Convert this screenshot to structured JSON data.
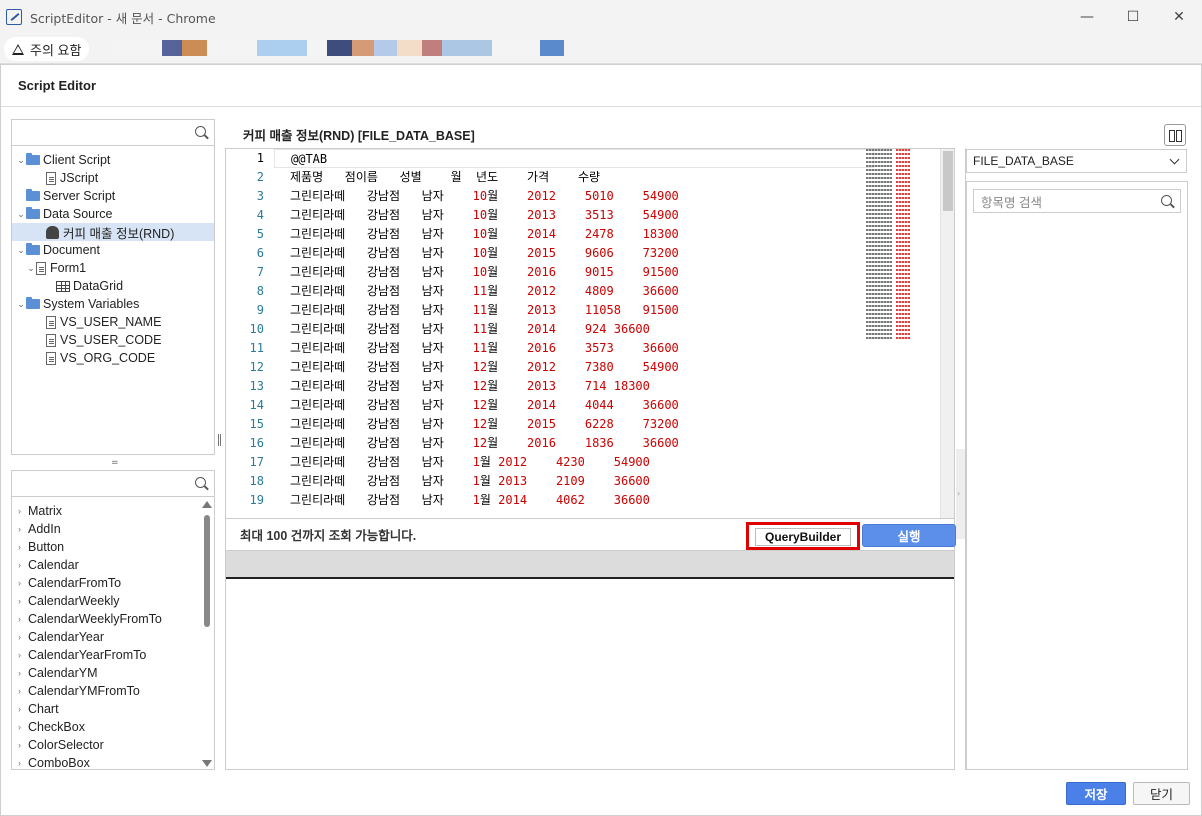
{
  "window": {
    "title": "ScriptEditor - 새 문서 - Chrome",
    "minimize": "—",
    "maximize": "☐",
    "close": "✕"
  },
  "address": {
    "warning": "주의 요함"
  },
  "header": {
    "title": "Script Editor"
  },
  "tree": {
    "items": [
      {
        "label": "Client Script",
        "icon": "folder-icon",
        "caret": "⌄"
      },
      {
        "label": "JScript",
        "icon": "file-icon"
      },
      {
        "label": "Server Script",
        "icon": "folder-icon"
      },
      {
        "label": "Data Source",
        "icon": "folder-icon",
        "caret": "⌄"
      },
      {
        "label": "커피 매출 정보(RND)",
        "icon": "database-icon",
        "selected": true
      },
      {
        "label": "Document",
        "icon": "folder-icon",
        "caret": "⌄"
      },
      {
        "label": "Form1",
        "icon": "file-icon",
        "caret": "⌄"
      },
      {
        "label": "DataGrid",
        "icon": "grid-icon"
      },
      {
        "label": "System Variables",
        "icon": "folder-icon",
        "caret": "⌄"
      },
      {
        "label": "VS_USER_NAME",
        "icon": "file-icon"
      },
      {
        "label": "VS_USER_CODE",
        "icon": "file-icon"
      },
      {
        "label": "VS_ORG_CODE",
        "icon": "file-icon"
      }
    ]
  },
  "splitter": {
    "symbol": "=",
    "vertical": "||"
  },
  "components": {
    "items": [
      "Matrix",
      "AddIn",
      "Button",
      "Calendar",
      "CalendarFromTo",
      "CalendarWeekly",
      "CalendarWeeklyFromTo",
      "CalendarYear",
      "CalendarYearFromTo",
      "CalendarYM",
      "CalendarYMFromTo",
      "Chart",
      "CheckBox",
      "ColorSelector",
      "ComboBox"
    ]
  },
  "editor": {
    "title": "커피 매출 정보(RND)  [FILE_DATA_BASE]",
    "lines": [
      [
        {
          "text": "@@TAB",
          "kind": "t"
        }
      ],
      [
        {
          "text": "제품명   점이름   성별    월  년도    가격    수량",
          "kind": "t"
        }
      ],
      [
        {
          "text": "그린티라떼   강남점   남자    ",
          "kind": "t"
        },
        {
          "text": "10",
          "kind": "n"
        },
        {
          "text": "월",
          "kind": "t"
        },
        {
          "text": "    2012    5010    54900",
          "kind": "n"
        }
      ],
      [
        {
          "text": "그린티라떼   강남점   남자    ",
          "kind": "t"
        },
        {
          "text": "10",
          "kind": "n"
        },
        {
          "text": "월",
          "kind": "t"
        },
        {
          "text": "    2013    3513    54900",
          "kind": "n"
        }
      ],
      [
        {
          "text": "그린티라떼   강남점   남자    ",
          "kind": "t"
        },
        {
          "text": "10",
          "kind": "n"
        },
        {
          "text": "월",
          "kind": "t"
        },
        {
          "text": "    2014    2478    18300",
          "kind": "n"
        }
      ],
      [
        {
          "text": "그린티라떼   강남점   남자    ",
          "kind": "t"
        },
        {
          "text": "10",
          "kind": "n"
        },
        {
          "text": "월",
          "kind": "t"
        },
        {
          "text": "    2015    9606    73200",
          "kind": "n"
        }
      ],
      [
        {
          "text": "그린티라떼   강남점   남자    ",
          "kind": "t"
        },
        {
          "text": "10",
          "kind": "n"
        },
        {
          "text": "월",
          "kind": "t"
        },
        {
          "text": "    2016    9015    91500",
          "kind": "n"
        }
      ],
      [
        {
          "text": "그린티라떼   강남점   남자    ",
          "kind": "t"
        },
        {
          "text": "11",
          "kind": "n"
        },
        {
          "text": "월",
          "kind": "t"
        },
        {
          "text": "    2012    4809    36600",
          "kind": "n"
        }
      ],
      [
        {
          "text": "그린티라떼   강남점   남자    ",
          "kind": "t"
        },
        {
          "text": "11",
          "kind": "n"
        },
        {
          "text": "월",
          "kind": "t"
        },
        {
          "text": "    2013    11058   91500",
          "kind": "n"
        }
      ],
      [
        {
          "text": "그린티라떼   강남점   남자    ",
          "kind": "t"
        },
        {
          "text": "11",
          "kind": "n"
        },
        {
          "text": "월",
          "kind": "t"
        },
        {
          "text": "    2014    924 36600",
          "kind": "n"
        }
      ],
      [
        {
          "text": "그린티라떼   강남점   남자    ",
          "kind": "t"
        },
        {
          "text": "11",
          "kind": "n"
        },
        {
          "text": "월",
          "kind": "t"
        },
        {
          "text": "    2016    3573    36600",
          "kind": "n"
        }
      ],
      [
        {
          "text": "그린티라떼   강남점   남자    ",
          "kind": "t"
        },
        {
          "text": "12",
          "kind": "n"
        },
        {
          "text": "월",
          "kind": "t"
        },
        {
          "text": "    2012    7380    54900",
          "kind": "n"
        }
      ],
      [
        {
          "text": "그린티라떼   강남점   남자    ",
          "kind": "t"
        },
        {
          "text": "12",
          "kind": "n"
        },
        {
          "text": "월",
          "kind": "t"
        },
        {
          "text": "    2013    714 18300",
          "kind": "n"
        }
      ],
      [
        {
          "text": "그린티라떼   강남점   남자    ",
          "kind": "t"
        },
        {
          "text": "12",
          "kind": "n"
        },
        {
          "text": "월",
          "kind": "t"
        },
        {
          "text": "    2014    4044    36600",
          "kind": "n"
        }
      ],
      [
        {
          "text": "그린티라떼   강남점   남자    ",
          "kind": "t"
        },
        {
          "text": "12",
          "kind": "n"
        },
        {
          "text": "월",
          "kind": "t"
        },
        {
          "text": "    2015    6228    73200",
          "kind": "n"
        }
      ],
      [
        {
          "text": "그린티라떼   강남점   남자    ",
          "kind": "t"
        },
        {
          "text": "12",
          "kind": "n"
        },
        {
          "text": "월",
          "kind": "t"
        },
        {
          "text": "    2016    1836    36600",
          "kind": "n"
        }
      ],
      [
        {
          "text": "그린티라떼   강남점   남자    ",
          "kind": "t"
        },
        {
          "text": "1",
          "kind": "n"
        },
        {
          "text": "월",
          "kind": "t"
        },
        {
          "text": " 2012    4230    54900",
          "kind": "n"
        }
      ],
      [
        {
          "text": "그린티라떼   강남점   남자    ",
          "kind": "t"
        },
        {
          "text": "1",
          "kind": "n"
        },
        {
          "text": "월",
          "kind": "t"
        },
        {
          "text": " 2013    2109    36600",
          "kind": "n"
        }
      ],
      [
        {
          "text": "그린티라떼   강남점   남자    ",
          "kind": "t"
        },
        {
          "text": "1",
          "kind": "n"
        },
        {
          "text": "월",
          "kind": "t"
        },
        {
          "text": " 2014    4062    36600",
          "kind": "n"
        }
      ]
    ],
    "notice": "최대 100 건까지 조회 가능합니다.",
    "query_builder": "QueryBuilder",
    "run": "실행"
  },
  "right": {
    "datasource": "FILE_DATA_BASE",
    "search_placeholder": "항목명 검색"
  },
  "footer": {
    "save": "저장",
    "close": "닫기"
  }
}
